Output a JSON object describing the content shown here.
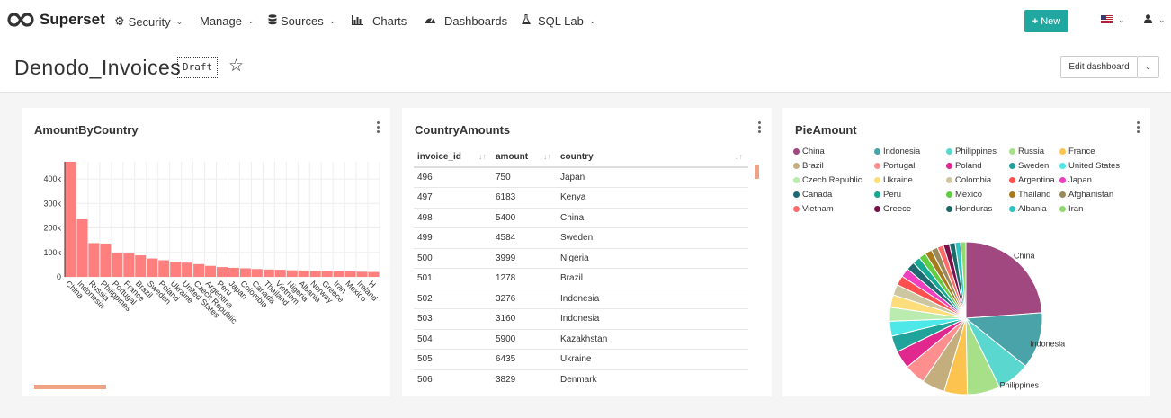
{
  "app": {
    "brand": "Superset"
  },
  "nav": {
    "security": "Security",
    "manage": "Manage",
    "sources": "Sources",
    "charts": "Charts",
    "dashboards": "Dashboards",
    "sqllab": "SQL Lab",
    "new_label": "New"
  },
  "header": {
    "title": "Denodo_Invoices",
    "badge": "Draft",
    "edit_label": "Edit dashboard"
  },
  "cards": {
    "bar_title": "AmountByCountry",
    "table_title": "CountryAmounts",
    "pie_title": "PieAmount"
  },
  "table": {
    "columns": [
      "invoice_id",
      "amount",
      "country"
    ],
    "rows": [
      [
        "496",
        "750",
        "Japan"
      ],
      [
        "497",
        "6183",
        "Kenya"
      ],
      [
        "498",
        "5400",
        "China"
      ],
      [
        "499",
        "4584",
        "Sweden"
      ],
      [
        "500",
        "3999",
        "Nigeria"
      ],
      [
        "501",
        "1278",
        "Brazil"
      ],
      [
        "502",
        "3276",
        "Indonesia"
      ],
      [
        "503",
        "3160",
        "Indonesia"
      ],
      [
        "504",
        "5900",
        "Kazakhstan"
      ],
      [
        "505",
        "6435",
        "Ukraine"
      ],
      [
        "506",
        "3829",
        "Denmark"
      ]
    ]
  },
  "chart_data": [
    {
      "type": "bar",
      "title": "AmountByCountry",
      "color": "#ff7f7f",
      "ylim": [
        0,
        470000
      ],
      "yticks": [
        "400k",
        "300k",
        "200k",
        "100k",
        "0"
      ],
      "ytick_values": [
        400000,
        300000,
        200000,
        100000,
        0
      ],
      "categories": [
        "China",
        "Indonesia",
        "Russia",
        "Philippines",
        "Portugal",
        "France",
        "Brazil",
        "Sweden",
        "Poland",
        "Ukraine",
        "United States",
        "Czech Republic",
        "Argentina",
        "Peru",
        "Japan",
        "Colombia",
        "Canada",
        "Thailand",
        "Vietnam",
        "Nigeria",
        "Albania",
        "Norway",
        "Greece",
        "Iran",
        "Mexico",
        "Ireland",
        "H"
      ],
      "values": [
        470000,
        235000,
        138000,
        136000,
        97000,
        96000,
        88000,
        75000,
        68000,
        62000,
        58000,
        52000,
        45000,
        40000,
        37000,
        35000,
        32000,
        30000,
        29000,
        27000,
        26000,
        25000,
        24000,
        23000,
        22000,
        21000,
        20000
      ]
    },
    {
      "type": "pie",
      "title": "PieAmount",
      "legend_placement": "top",
      "labels": [
        "China",
        "Indonesia",
        "Philippines",
        "Russia",
        "France",
        "Brazil",
        "Portugal",
        "Poland",
        "Sweden",
        "United States",
        "Czech Republic",
        "Ukraine",
        "Colombia",
        "Argentina",
        "Japan",
        "Canada",
        "Peru",
        "Mexico",
        "Thailand",
        "Afghanistan",
        "Vietnam",
        "Greece",
        "Honduras",
        "Albania",
        "Iran"
      ],
      "colors": [
        "#a0487f",
        "#4aa3a8",
        "#5ad8d0",
        "#a8e08a",
        "#fcc44e",
        "#c5ae7e",
        "#ff8f8f",
        "#e0288f",
        "#1fa39a",
        "#4fe8e8",
        "#b9ecae",
        "#fddc7c",
        "#ccc7a0",
        "#ff4f4f",
        "#ef3fbf",
        "#1e6a70",
        "#15a893",
        "#62cd40",
        "#a87a1e",
        "#9a8a5a",
        "#ff6a6a",
        "#7a0f4a",
        "#1a6a6a",
        "#2ec4c4",
        "#90d870"
      ],
      "values": [
        470000,
        235000,
        138000,
        136000,
        97000,
        96000,
        88000,
        75000,
        68000,
        62000,
        58000,
        52000,
        45000,
        40000,
        37000,
        35000,
        32000,
        30000,
        29000,
        27000,
        26000,
        25000,
        24000,
        23000,
        22000
      ]
    }
  ]
}
